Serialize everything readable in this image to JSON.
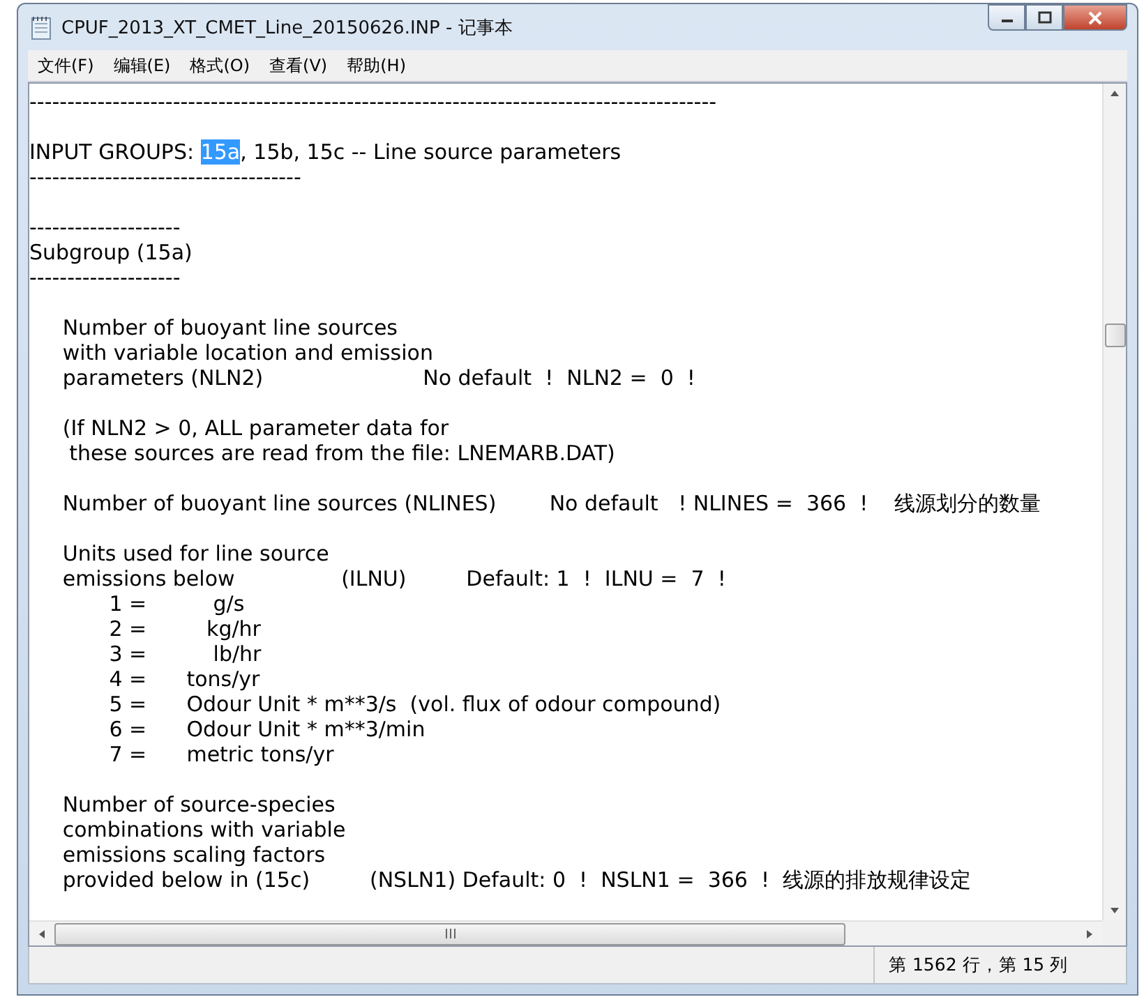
{
  "window": {
    "title": "CPUF_2013_XT_CMET_Line_20150626.INP - 记事本"
  },
  "menu": [
    "文件(F)",
    "编辑(E)",
    "格式(O)",
    "查看(V)",
    "帮助(H)"
  ],
  "blocks": [
    [
      [
        {
          "text": "-------------------------------------------------------------------------------------------"
        }
      ]
    ],
    [
      [
        {
          "text": "INPUT GROUPS: "
        },
        {
          "text": "15a",
          "selected": true
        },
        {
          "text": ", 15b, 15c -- Line source parameters"
        }
      ],
      [
        {
          "text": "------------------------------------"
        }
      ]
    ],
    [
      [
        {
          "text": "--------------------"
        }
      ],
      [
        {
          "text": "Subgroup (15a)"
        }
      ],
      [
        {
          "text": "--------------------"
        }
      ]
    ],
    [
      [
        {
          "text": "     Number of buoyant line sources"
        }
      ],
      [
        {
          "text": "     with variable location and emission"
        }
      ],
      [
        {
          "text": "     parameters (NLN2)                        No default  !  NLN2 =  0  !"
        }
      ]
    ],
    [
      [
        {
          "text": "     (If NLN2 > 0, ALL parameter data for"
        }
      ],
      [
        {
          "text": "      these sources are read from the file: LNEMARB.DAT)"
        }
      ]
    ],
    [
      [
        {
          "text": "     Number of buoyant line sources (NLINES)        No default   ! NLINES =  366  !    线源划分的数量"
        }
      ]
    ],
    [
      [
        {
          "text": "     Units used for line source"
        }
      ],
      [
        {
          "text": "     emissions below                (ILNU)         Default: 1  !  ILNU =  7  !"
        }
      ],
      [
        {
          "text": "            1 =          g/s"
        }
      ],
      [
        {
          "text": "            2 =         kg/hr"
        }
      ],
      [
        {
          "text": "            3 =          lb/hr"
        }
      ],
      [
        {
          "text": "            4 =      tons/yr"
        }
      ],
      [
        {
          "text": "            5 =      Odour Unit * m**3/s  (vol. flux of odour compound)"
        }
      ],
      [
        {
          "text": "            6 =      Odour Unit * m**3/min"
        }
      ],
      [
        {
          "text": "            7 =      metric tons/yr"
        }
      ]
    ],
    [
      [
        {
          "text": "     Number of source-species"
        }
      ],
      [
        {
          "text": "     combinations with variable"
        }
      ],
      [
        {
          "text": "     emissions scaling factors"
        }
      ],
      [
        {
          "text": "     provided below in (15c)         (NSLN1) Default: 0  !  NSLN1 =  366  !  线源的排放规律设定"
        }
      ]
    ]
  ],
  "status_bar": {
    "position": "第 1562 行，第 15 列"
  }
}
